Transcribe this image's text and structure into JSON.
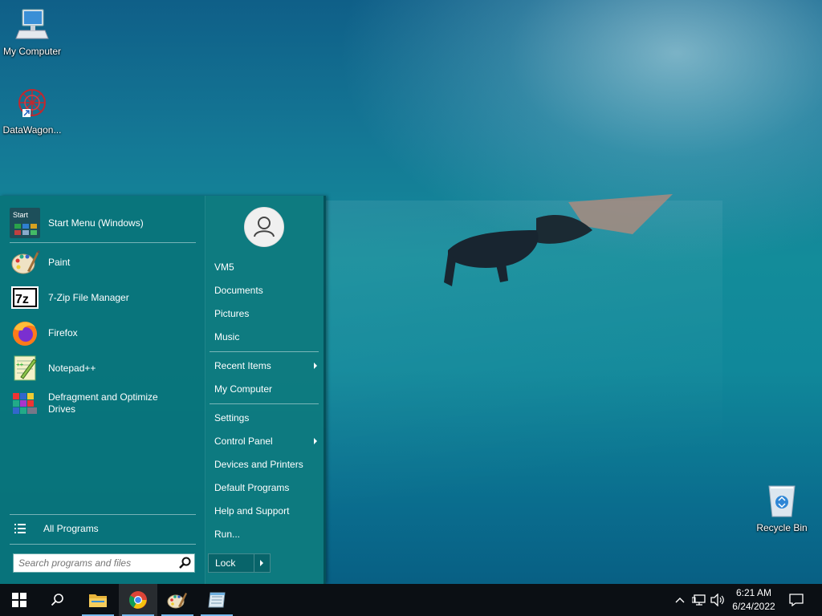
{
  "desktop": {
    "icons": [
      {
        "label": "My Computer",
        "icon": "computer-icon"
      },
      {
        "label": "DataWagon...",
        "icon": "datawagon-icon"
      },
      {
        "label": "Recycle Bin",
        "icon": "recycle-bin-icon"
      }
    ]
  },
  "start_menu": {
    "pinned": {
      "label": "Start Menu (Windows)",
      "icon": "start-menu-icon"
    },
    "programs": [
      {
        "label": "Paint",
        "icon": "paint-icon"
      },
      {
        "label": "7-Zip File Manager",
        "icon": "7zip-icon"
      },
      {
        "label": "Firefox",
        "icon": "firefox-icon"
      },
      {
        "label": "Notepad++",
        "icon": "notepadpp-icon"
      },
      {
        "label": "Defragment and Optimize Drives",
        "icon": "defrag-icon"
      }
    ],
    "all_programs": "All Programs",
    "search_placeholder": "Search programs and files",
    "right_items": [
      {
        "label": "VM5"
      },
      {
        "label": "Documents"
      },
      {
        "label": "Pictures"
      },
      {
        "label": "Music"
      },
      {
        "label": "Recent Items",
        "submenu": true
      },
      {
        "label": "My Computer"
      },
      {
        "label": "Settings"
      },
      {
        "label": "Control Panel",
        "submenu": true
      },
      {
        "label": "Devices and Printers"
      },
      {
        "label": "Default Programs"
      },
      {
        "label": "Help and Support"
      },
      {
        "label": "Run..."
      }
    ],
    "lock_label": "Lock"
  },
  "taskbar": {
    "buttons": [
      "windows-start-icon",
      "search-icon",
      "file-explorer-icon",
      "chrome-icon",
      "paint-icon",
      "notepad-icon"
    ],
    "tray_icons": [
      "chevron-up-icon",
      "network-icon",
      "volume-icon"
    ],
    "time": "6:21 AM",
    "date": "6/24/2022",
    "notification_icon": "action-center-icon"
  },
  "colors": {
    "menu_bg": "#08747a",
    "taskbar_bg": "#0b0f14",
    "accent_underline": "#76b9ed"
  }
}
